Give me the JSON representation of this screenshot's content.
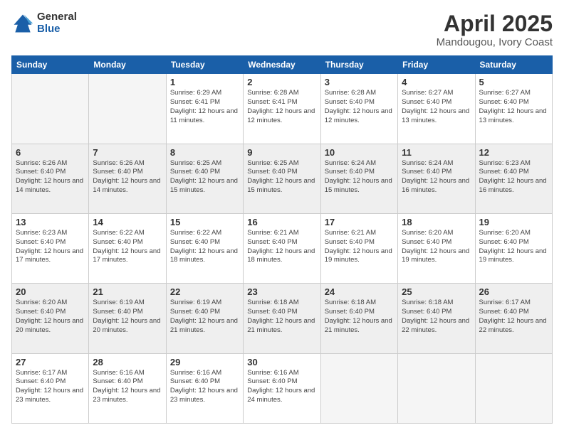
{
  "header": {
    "logo_general": "General",
    "logo_blue": "Blue",
    "title": "April 2025",
    "subtitle": "Mandougou, Ivory Coast"
  },
  "days_of_week": [
    "Sunday",
    "Monday",
    "Tuesday",
    "Wednesday",
    "Thursday",
    "Friday",
    "Saturday"
  ],
  "weeks": [
    [
      {
        "day": "",
        "sunrise": "",
        "sunset": "",
        "daylight": "",
        "empty": true
      },
      {
        "day": "",
        "sunrise": "",
        "sunset": "",
        "daylight": "",
        "empty": true
      },
      {
        "day": "1",
        "sunrise": "Sunrise: 6:29 AM",
        "sunset": "Sunset: 6:41 PM",
        "daylight": "Daylight: 12 hours and 11 minutes."
      },
      {
        "day": "2",
        "sunrise": "Sunrise: 6:28 AM",
        "sunset": "Sunset: 6:41 PM",
        "daylight": "Daylight: 12 hours and 12 minutes."
      },
      {
        "day": "3",
        "sunrise": "Sunrise: 6:28 AM",
        "sunset": "Sunset: 6:40 PM",
        "daylight": "Daylight: 12 hours and 12 minutes."
      },
      {
        "day": "4",
        "sunrise": "Sunrise: 6:27 AM",
        "sunset": "Sunset: 6:40 PM",
        "daylight": "Daylight: 12 hours and 13 minutes."
      },
      {
        "day": "5",
        "sunrise": "Sunrise: 6:27 AM",
        "sunset": "Sunset: 6:40 PM",
        "daylight": "Daylight: 12 hours and 13 minutes."
      }
    ],
    [
      {
        "day": "6",
        "sunrise": "Sunrise: 6:26 AM",
        "sunset": "Sunset: 6:40 PM",
        "daylight": "Daylight: 12 hours and 14 minutes."
      },
      {
        "day": "7",
        "sunrise": "Sunrise: 6:26 AM",
        "sunset": "Sunset: 6:40 PM",
        "daylight": "Daylight: 12 hours and 14 minutes."
      },
      {
        "day": "8",
        "sunrise": "Sunrise: 6:25 AM",
        "sunset": "Sunset: 6:40 PM",
        "daylight": "Daylight: 12 hours and 15 minutes."
      },
      {
        "day": "9",
        "sunrise": "Sunrise: 6:25 AM",
        "sunset": "Sunset: 6:40 PM",
        "daylight": "Daylight: 12 hours and 15 minutes."
      },
      {
        "day": "10",
        "sunrise": "Sunrise: 6:24 AM",
        "sunset": "Sunset: 6:40 PM",
        "daylight": "Daylight: 12 hours and 15 minutes."
      },
      {
        "day": "11",
        "sunrise": "Sunrise: 6:24 AM",
        "sunset": "Sunset: 6:40 PM",
        "daylight": "Daylight: 12 hours and 16 minutes."
      },
      {
        "day": "12",
        "sunrise": "Sunrise: 6:23 AM",
        "sunset": "Sunset: 6:40 PM",
        "daylight": "Daylight: 12 hours and 16 minutes."
      }
    ],
    [
      {
        "day": "13",
        "sunrise": "Sunrise: 6:23 AM",
        "sunset": "Sunset: 6:40 PM",
        "daylight": "Daylight: 12 hours and 17 minutes."
      },
      {
        "day": "14",
        "sunrise": "Sunrise: 6:22 AM",
        "sunset": "Sunset: 6:40 PM",
        "daylight": "Daylight: 12 hours and 17 minutes."
      },
      {
        "day": "15",
        "sunrise": "Sunrise: 6:22 AM",
        "sunset": "Sunset: 6:40 PM",
        "daylight": "Daylight: 12 hours and 18 minutes."
      },
      {
        "day": "16",
        "sunrise": "Sunrise: 6:21 AM",
        "sunset": "Sunset: 6:40 PM",
        "daylight": "Daylight: 12 hours and 18 minutes."
      },
      {
        "day": "17",
        "sunrise": "Sunrise: 6:21 AM",
        "sunset": "Sunset: 6:40 PM",
        "daylight": "Daylight: 12 hours and 19 minutes."
      },
      {
        "day": "18",
        "sunrise": "Sunrise: 6:20 AM",
        "sunset": "Sunset: 6:40 PM",
        "daylight": "Daylight: 12 hours and 19 minutes."
      },
      {
        "day": "19",
        "sunrise": "Sunrise: 6:20 AM",
        "sunset": "Sunset: 6:40 PM",
        "daylight": "Daylight: 12 hours and 19 minutes."
      }
    ],
    [
      {
        "day": "20",
        "sunrise": "Sunrise: 6:20 AM",
        "sunset": "Sunset: 6:40 PM",
        "daylight": "Daylight: 12 hours and 20 minutes."
      },
      {
        "day": "21",
        "sunrise": "Sunrise: 6:19 AM",
        "sunset": "Sunset: 6:40 PM",
        "daylight": "Daylight: 12 hours and 20 minutes."
      },
      {
        "day": "22",
        "sunrise": "Sunrise: 6:19 AM",
        "sunset": "Sunset: 6:40 PM",
        "daylight": "Daylight: 12 hours and 21 minutes."
      },
      {
        "day": "23",
        "sunrise": "Sunrise: 6:18 AM",
        "sunset": "Sunset: 6:40 PM",
        "daylight": "Daylight: 12 hours and 21 minutes."
      },
      {
        "day": "24",
        "sunrise": "Sunrise: 6:18 AM",
        "sunset": "Sunset: 6:40 PM",
        "daylight": "Daylight: 12 hours and 21 minutes."
      },
      {
        "day": "25",
        "sunrise": "Sunrise: 6:18 AM",
        "sunset": "Sunset: 6:40 PM",
        "daylight": "Daylight: 12 hours and 22 minutes."
      },
      {
        "day": "26",
        "sunrise": "Sunrise: 6:17 AM",
        "sunset": "Sunset: 6:40 PM",
        "daylight": "Daylight: 12 hours and 22 minutes."
      }
    ],
    [
      {
        "day": "27",
        "sunrise": "Sunrise: 6:17 AM",
        "sunset": "Sunset: 6:40 PM",
        "daylight": "Daylight: 12 hours and 23 minutes."
      },
      {
        "day": "28",
        "sunrise": "Sunrise: 6:16 AM",
        "sunset": "Sunset: 6:40 PM",
        "daylight": "Daylight: 12 hours and 23 minutes."
      },
      {
        "day": "29",
        "sunrise": "Sunrise: 6:16 AM",
        "sunset": "Sunset: 6:40 PM",
        "daylight": "Daylight: 12 hours and 23 minutes."
      },
      {
        "day": "30",
        "sunrise": "Sunrise: 6:16 AM",
        "sunset": "Sunset: 6:40 PM",
        "daylight": "Daylight: 12 hours and 24 minutes."
      },
      {
        "day": "",
        "sunrise": "",
        "sunset": "",
        "daylight": "",
        "empty": true
      },
      {
        "day": "",
        "sunrise": "",
        "sunset": "",
        "daylight": "",
        "empty": true
      },
      {
        "day": "",
        "sunrise": "",
        "sunset": "",
        "daylight": "",
        "empty": true
      }
    ]
  ]
}
